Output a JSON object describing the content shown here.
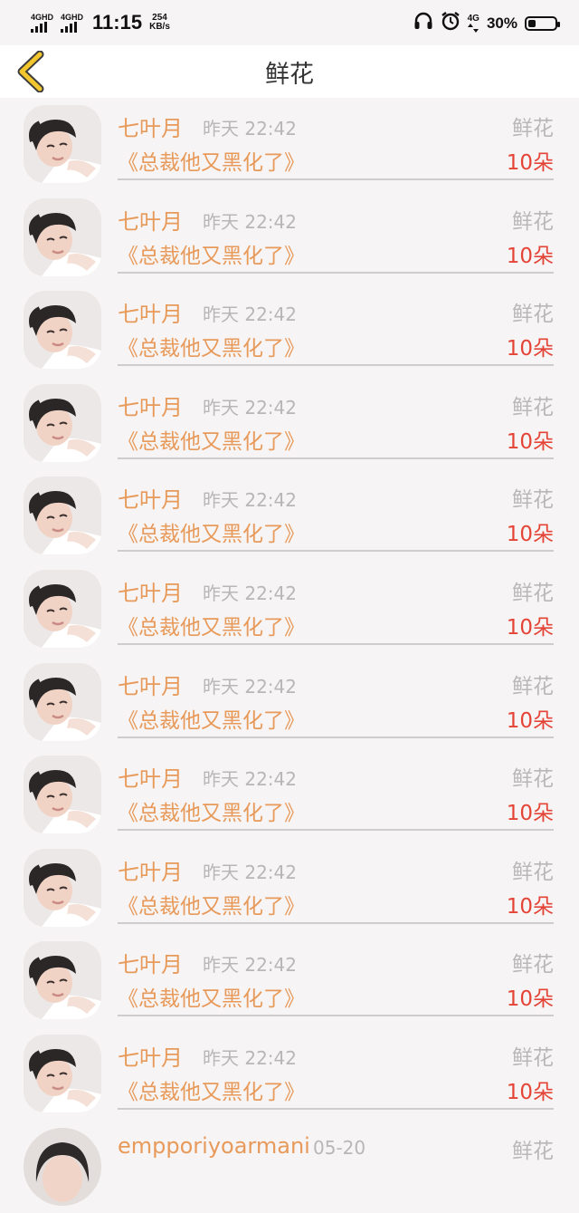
{
  "status_bar": {
    "network_1": "4GHD",
    "network_2": "4GHD",
    "time": "11:15",
    "speed_value": "254",
    "speed_unit": "KB/s",
    "network_3": "4G",
    "battery_percent": "30%",
    "battery_level": 0.3,
    "icons": [
      "headphones-icon",
      "alarm-icon",
      "4g-data-icon",
      "battery-icon"
    ]
  },
  "header": {
    "title": "鲜花",
    "back_icon": "chevron-left-icon",
    "accent_color": "#f3c62e"
  },
  "colors": {
    "name": "#e79a5a",
    "book": "#e79a5a",
    "count": "#e44436",
    "muted": "#b7b7b7"
  },
  "records": [
    {
      "user": "七叶月",
      "time": "昨天 22:42",
      "book": "《总裁他又黑化了》",
      "gift": "鲜花",
      "count": "10朵"
    },
    {
      "user": "七叶月",
      "time": "昨天 22:42",
      "book": "《总裁他又黑化了》",
      "gift": "鲜花",
      "count": "10朵"
    },
    {
      "user": "七叶月",
      "time": "昨天 22:42",
      "book": "《总裁他又黑化了》",
      "gift": "鲜花",
      "count": "10朵"
    },
    {
      "user": "七叶月",
      "time": "昨天 22:42",
      "book": "《总裁他又黑化了》",
      "gift": "鲜花",
      "count": "10朵"
    },
    {
      "user": "七叶月",
      "time": "昨天 22:42",
      "book": "《总裁他又黑化了》",
      "gift": "鲜花",
      "count": "10朵"
    },
    {
      "user": "七叶月",
      "time": "昨天 22:42",
      "book": "《总裁他又黑化了》",
      "gift": "鲜花",
      "count": "10朵"
    },
    {
      "user": "七叶月",
      "time": "昨天 22:42",
      "book": "《总裁他又黑化了》",
      "gift": "鲜花",
      "count": "10朵"
    },
    {
      "user": "七叶月",
      "time": "昨天 22:42",
      "book": "《总裁他又黑化了》",
      "gift": "鲜花",
      "count": "10朵"
    },
    {
      "user": "七叶月",
      "time": "昨天 22:42",
      "book": "《总裁他又黑化了》",
      "gift": "鲜花",
      "count": "10朵"
    },
    {
      "user": "七叶月",
      "time": "昨天 22:42",
      "book": "《总裁他又黑化了》",
      "gift": "鲜花",
      "count": "10朵"
    },
    {
      "user": "七叶月",
      "time": "昨天 22:42",
      "book": "《总裁他又黑化了》",
      "gift": "鲜花",
      "count": "10朵"
    },
    {
      "user": "empporiyoarmani",
      "time": "05-20",
      "book": "",
      "gift": "鲜花",
      "count": ""
    }
  ]
}
